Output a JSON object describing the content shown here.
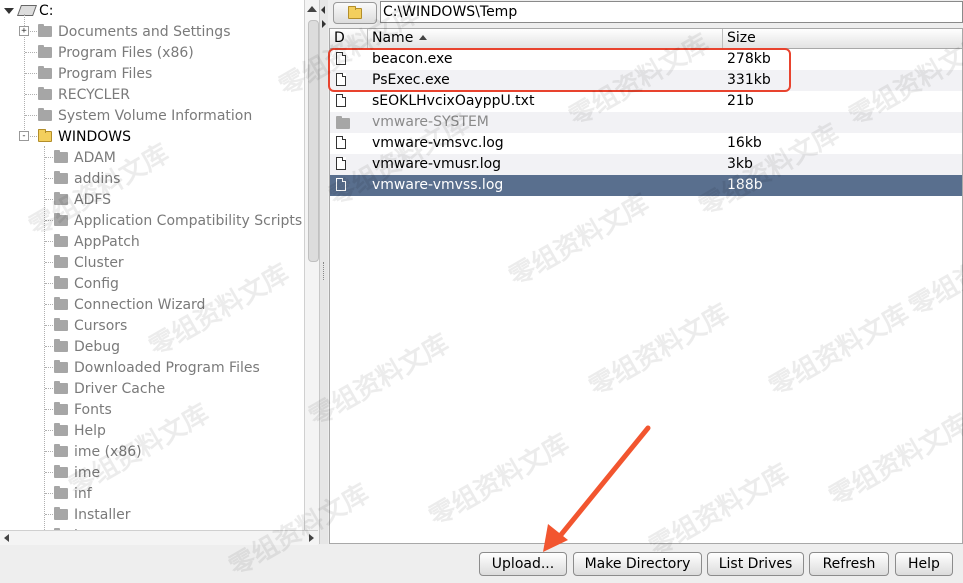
{
  "tree": {
    "root_label": "C:",
    "items": [
      {
        "label": "Documents and Settings",
        "level": 1,
        "expander": "+"
      },
      {
        "label": "Program Files (x86)",
        "level": 1
      },
      {
        "label": "Program Files",
        "level": 1
      },
      {
        "label": "RECYCLER",
        "level": 1
      },
      {
        "label": "System Volume Information",
        "level": 1
      },
      {
        "label": "WINDOWS",
        "level": 1,
        "expander": "-",
        "open": true
      },
      {
        "label": "ADAM",
        "level": 2
      },
      {
        "label": "addins",
        "level": 2
      },
      {
        "label": "ADFS",
        "level": 2
      },
      {
        "label": "Application Compatibility Scripts",
        "level": 2
      },
      {
        "label": "AppPatch",
        "level": 2
      },
      {
        "label": "Cluster",
        "level": 2
      },
      {
        "label": "Config",
        "level": 2
      },
      {
        "label": "Connection Wizard",
        "level": 2
      },
      {
        "label": "Cursors",
        "level": 2
      },
      {
        "label": "Debug",
        "level": 2
      },
      {
        "label": "Downloaded Program Files",
        "level": 2
      },
      {
        "label": "Driver Cache",
        "level": 2
      },
      {
        "label": "Fonts",
        "level": 2
      },
      {
        "label": "Help",
        "level": 2
      },
      {
        "label": "ime (x86)",
        "level": 2
      },
      {
        "label": "ime",
        "level": 2
      },
      {
        "label": "inf",
        "level": 2
      },
      {
        "label": "Installer",
        "level": 2
      },
      {
        "label": "java",
        "level": 2
      }
    ]
  },
  "path": {
    "value": "C:\\WINDOWS\\Temp"
  },
  "filelist": {
    "columns": {
      "d": "D",
      "name": "Name",
      "size": "Size"
    },
    "rows": [
      {
        "name": "beacon.exe",
        "size": "278kb",
        "icon": "file-icon"
      },
      {
        "name": "PsExec.exe",
        "size": "331kb",
        "icon": "file-icon"
      },
      {
        "name": "sEOKLHvcixOayppU.txt",
        "size": "21b",
        "icon": "file-icon"
      },
      {
        "name": "vmware-SYSTEM",
        "size": "",
        "icon": "folder-icon",
        "dim": true
      },
      {
        "name": "vmware-vmsvc.log",
        "size": "16kb",
        "icon": "file-icon"
      },
      {
        "name": "vmware-vmusr.log",
        "size": "3kb",
        "icon": "file-icon"
      },
      {
        "name": "vmware-vmvss.log",
        "size": "188b",
        "icon": "file-icon",
        "selected": true
      }
    ]
  },
  "buttons": {
    "upload": "Upload...",
    "make_directory": "Make Directory",
    "list_drives": "List Drives",
    "refresh": "Refresh",
    "help": "Help"
  },
  "watermark": "零组资料文库",
  "colors": {
    "selection": "#596f8e",
    "highlight": "#e8432e",
    "folder_open": "#f3cf5d"
  }
}
